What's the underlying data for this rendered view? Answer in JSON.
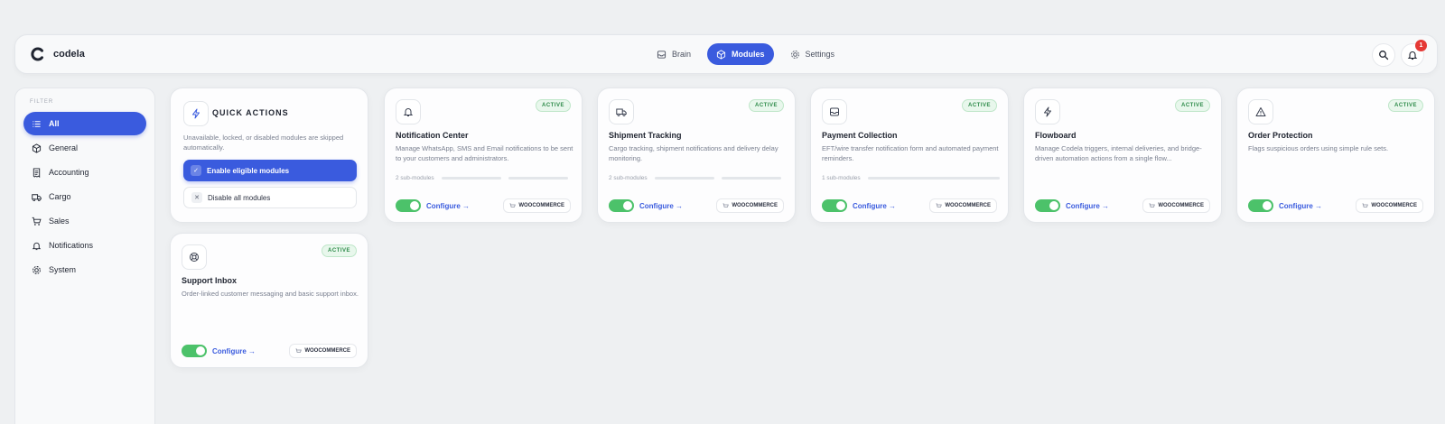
{
  "app": {
    "name": "codela"
  },
  "nav": {
    "tabs": [
      {
        "label": "Brain",
        "icon": "inbox-icon"
      },
      {
        "label": "Modules",
        "icon": "box-icon",
        "active": true
      },
      {
        "label": "Settings",
        "icon": "gear-icon"
      }
    ]
  },
  "notifications": {
    "count": "1"
  },
  "sidebar": {
    "filter_label": "FILTER",
    "items": [
      {
        "label": "All",
        "icon": "list-icon",
        "active": true
      },
      {
        "label": "General",
        "icon": "cube-icon"
      },
      {
        "label": "Accounting",
        "icon": "receipt-icon"
      },
      {
        "label": "Cargo",
        "icon": "truck-icon"
      },
      {
        "label": "Sales",
        "icon": "cart-icon"
      },
      {
        "label": "Notifications",
        "icon": "bell-icon"
      },
      {
        "label": "System",
        "icon": "gear-icon"
      }
    ]
  },
  "quick_actions": {
    "title": "QUICK ACTIONS",
    "description": "Unavailable, locked, or disabled modules are skipped automatically.",
    "enable_label": "Enable eligible modules",
    "disable_label": "Disable all modules"
  },
  "modules": [
    {
      "title": "Notification Center",
      "description": "Manage WhatsApp, SMS and Email notifications to be sent to your customers and administrators.",
      "status": "ACTIVE",
      "sub_modules": "2 sub-modules",
      "configure": "Configure →",
      "platform": "WOOCOMMERCE",
      "icon": "bell-icon",
      "enabled": true
    },
    {
      "title": "Shipment Tracking",
      "description": "Cargo tracking, shipment notifications and delivery delay monitoring.",
      "status": "ACTIVE",
      "sub_modules": "2 sub-modules",
      "configure": "Configure →",
      "platform": "WOOCOMMERCE",
      "icon": "truck-icon",
      "enabled": true
    },
    {
      "title": "Payment Collection",
      "description": "EFT/wire transfer notification form and automated payment reminders.",
      "status": "ACTIVE",
      "sub_modules": "1 sub-modules",
      "configure": "Configure →",
      "platform": "WOOCOMMERCE",
      "icon": "inbox-icon",
      "enabled": true
    },
    {
      "title": "Flowboard",
      "description": "Manage Codela triggers, internal deliveries, and bridge-driven automation actions from a single flow...",
      "status": "ACTIVE",
      "sub_modules": "",
      "configure": "Configure →",
      "platform": "WOOCOMMERCE",
      "icon": "lightning-icon",
      "enabled": true
    },
    {
      "title": "Order Protection",
      "description": "Flags suspicious orders using simple rule sets.",
      "status": "ACTIVE",
      "sub_modules": "",
      "configure": "Configure →",
      "platform": "WOOCOMMERCE",
      "icon": "warning-icon",
      "enabled": true
    },
    {
      "title": "Support Inbox",
      "description": "Order-linked customer messaging and basic support inbox.",
      "status": "ACTIVE",
      "sub_modules": "",
      "configure": "Configure →",
      "platform": "WOOCOMMERCE",
      "icon": "lifebuoy-icon",
      "enabled": true
    }
  ],
  "colors": {
    "accent": "#3a5bde",
    "success": "#4cc26a",
    "badge": "#e53935"
  }
}
